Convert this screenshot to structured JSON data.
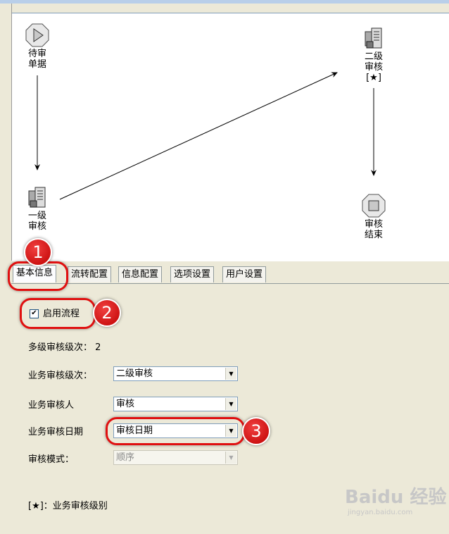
{
  "diagram": {
    "nodes": [
      {
        "id": "pending",
        "label": "待审\n单据",
        "icon": "play-icon"
      },
      {
        "id": "level1",
        "label": "一级\n审核",
        "icon": "audit-icon"
      },
      {
        "id": "level2",
        "label": "二级\n审核\n[★]",
        "icon": "audit-icon"
      },
      {
        "id": "end",
        "label": "审核\n结束",
        "icon": "stop-icon"
      }
    ]
  },
  "tabs": [
    {
      "label": "基本信息",
      "active": true
    },
    {
      "label": "流转配置",
      "active": false
    },
    {
      "label": "信息配置",
      "active": false
    },
    {
      "label": "选项设置",
      "active": false
    },
    {
      "label": "用户设置",
      "active": false
    }
  ],
  "form": {
    "enable_flow": {
      "label": "启用流程",
      "checked": true,
      "mark": "✔"
    },
    "levels_count": "多级审核级次：  2",
    "business_level": {
      "label": "业务审核级次：",
      "value": "二级审核"
    },
    "business_auditor": {
      "label": "业务审核人",
      "value": "审核"
    },
    "business_date": {
      "label": "业务审核日期",
      "value": "审核日期"
    },
    "audit_mode": {
      "label": "审核模式：",
      "value": "顺序"
    }
  },
  "note": "[★]：业务审核级别",
  "callouts": [
    "1",
    "2",
    "3"
  ],
  "watermark": {
    "text": "Baidu 经验",
    "sub": "jingyan.baidu.com"
  },
  "colors": {
    "callout": "#e01010",
    "canvas": "#ffffff",
    "panel": "#ece9d8"
  }
}
